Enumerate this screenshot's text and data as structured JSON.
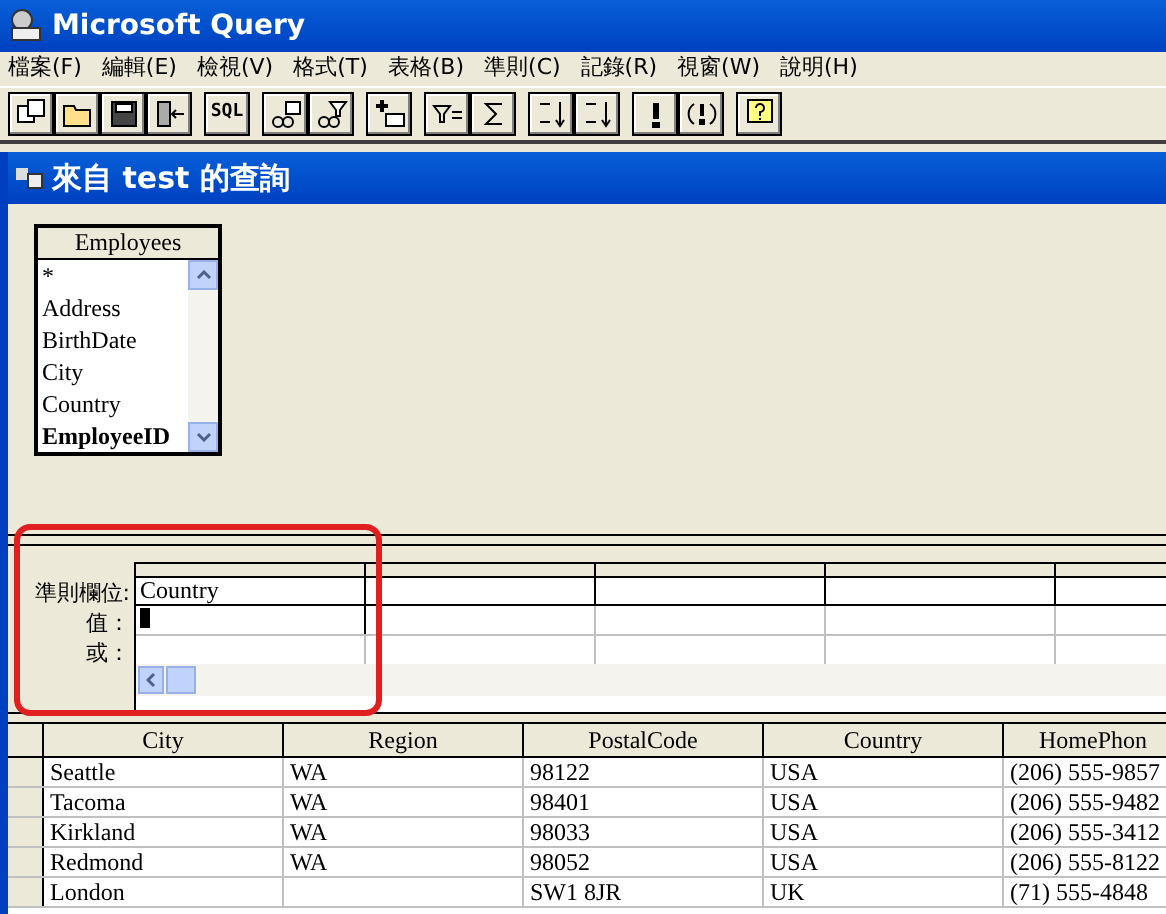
{
  "window": {
    "title": "Microsoft Query"
  },
  "menu": [
    "檔案(F)",
    "編輯(E)",
    "檢視(V)",
    "格式(T)",
    "表格(B)",
    "準則(C)",
    "記錄(R)",
    "視窗(W)",
    "說明(H)"
  ],
  "toolbar": [
    [
      {
        "kind": "new"
      },
      {
        "kind": "open"
      },
      {
        "kind": "save"
      },
      {
        "kind": "return"
      }
    ],
    [
      {
        "kind": "text",
        "label": "SQL"
      }
    ],
    [
      {
        "kind": "tables"
      },
      {
        "kind": "criteria"
      }
    ],
    [
      {
        "kind": "add"
      }
    ],
    [
      {
        "kind": "filter"
      },
      {
        "kind": "sum"
      }
    ],
    [
      {
        "kind": "sort_asc"
      },
      {
        "kind": "sort_desc"
      }
    ],
    [
      {
        "kind": "run"
      },
      {
        "kind": "auto"
      }
    ],
    [
      {
        "kind": "help"
      }
    ]
  ],
  "query_window": {
    "title": "來自 test 的查詢",
    "table": {
      "name": "Employees",
      "fields": [
        {
          "label": "*",
          "key": false
        },
        {
          "label": "Address",
          "key": false
        },
        {
          "label": "BirthDate",
          "key": false
        },
        {
          "label": "City",
          "key": false
        },
        {
          "label": "Country",
          "key": false
        },
        {
          "label": "EmployeeID",
          "key": true
        }
      ]
    },
    "criteria": {
      "row_labels": [
        "準則欄位:",
        "值：",
        "或："
      ],
      "field": "Country"
    },
    "results": {
      "columns": [
        "City",
        "Region",
        "PostalCode",
        "Country",
        "HomePhon"
      ],
      "rows": [
        [
          "Seattle",
          "WA",
          "98122",
          "USA",
          "(206) 555-9857"
        ],
        [
          "Tacoma",
          "WA",
          "98401",
          "USA",
          "(206) 555-9482"
        ],
        [
          "Kirkland",
          "WA",
          "98033",
          "USA",
          "(206) 555-3412"
        ],
        [
          "Redmond",
          "WA",
          "98052",
          "USA",
          "(206) 555-8122"
        ],
        [
          "London",
          "",
          "SW1 8JR",
          "UK",
          "(71) 555-4848"
        ]
      ]
    }
  }
}
